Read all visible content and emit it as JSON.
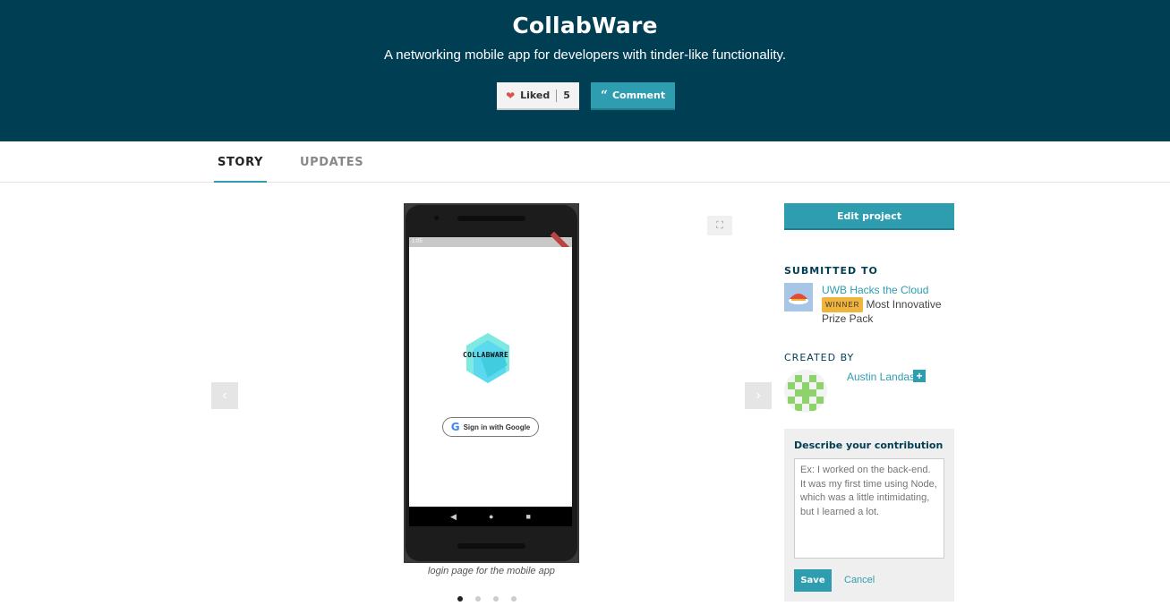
{
  "header": {
    "title": "CollabWare",
    "tagline": "A networking mobile app for developers with tinder-like functionality.",
    "like_label": "Liked",
    "like_count": "5",
    "comment_label": "Comment"
  },
  "tabs": [
    {
      "label": "STORY",
      "active": true
    },
    {
      "label": "UPDATES",
      "active": false
    }
  ],
  "gallery": {
    "caption": "login page for the mobile app",
    "slide_count": 4,
    "active_slide": 1,
    "screenshot": {
      "status_time": "1:05",
      "logo_text": "COLLABWARE",
      "google_button": "Sign in with Google"
    }
  },
  "sidebar": {
    "edit_label": "Edit project",
    "submitted_title": "SUBMITTED TO",
    "hackathon": "UWB Hacks the Cloud",
    "winner_badge": "WINNER",
    "prize": "Most Innovative Prize Pack",
    "created_title": "CREATED BY",
    "author": "Austin Landas",
    "contribution": {
      "title": "Describe your contribution",
      "placeholder": "Ex: I worked on the back-end. It was my first time using Node, which was a little intimidating, but I learned a lot.",
      "save_label": "Save",
      "cancel_label": "Cancel"
    }
  },
  "colors": {
    "header_bg": "#003e54",
    "accent": "#2e9db0",
    "winner": "#f0b43d",
    "heart": "#d9534f"
  },
  "icons": [
    "heart-icon",
    "quote-icon",
    "chevron-left-icon",
    "chevron-right-icon",
    "expand-icon",
    "plus-icon",
    "google-g-icon"
  ]
}
